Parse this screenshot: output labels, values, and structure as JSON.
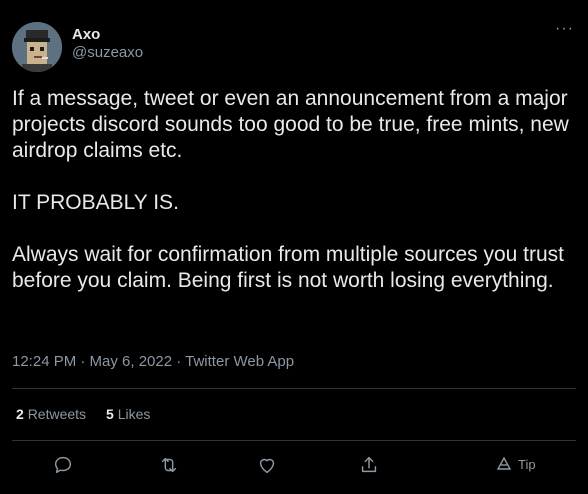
{
  "author": {
    "name": "Axo",
    "handle": "@suzeaxo",
    "avatar_icon": "pixel-punk-avatar-icon"
  },
  "more_label": "···",
  "tweet": {
    "paragraphs": [
      "If a message, tweet or even an announcement from a major projects discord sounds too good to be true, free mints, new airdrop claims etc.",
      "IT PROBABLY IS.",
      "Always wait for confirmation from multiple sources you trust before you claim. Being first is not worth losing everything."
    ],
    "timestamp": "12:24 PM · May 6, 2022 · Twitter Web App"
  },
  "stats": {
    "retweets_count": "2",
    "retweets_label": "Retweets",
    "likes_count": "5",
    "likes_label": "Likes"
  },
  "actions": {
    "reply_icon": "reply-icon",
    "retweet_icon": "retweet-icon",
    "like_icon": "heart-icon",
    "share_icon": "share-icon",
    "tip_label": "Tip"
  },
  "colors": {
    "background": "#000000",
    "text": "#e7e9ea",
    "secondary": "#8b98a5",
    "divider": "#2f3336"
  }
}
